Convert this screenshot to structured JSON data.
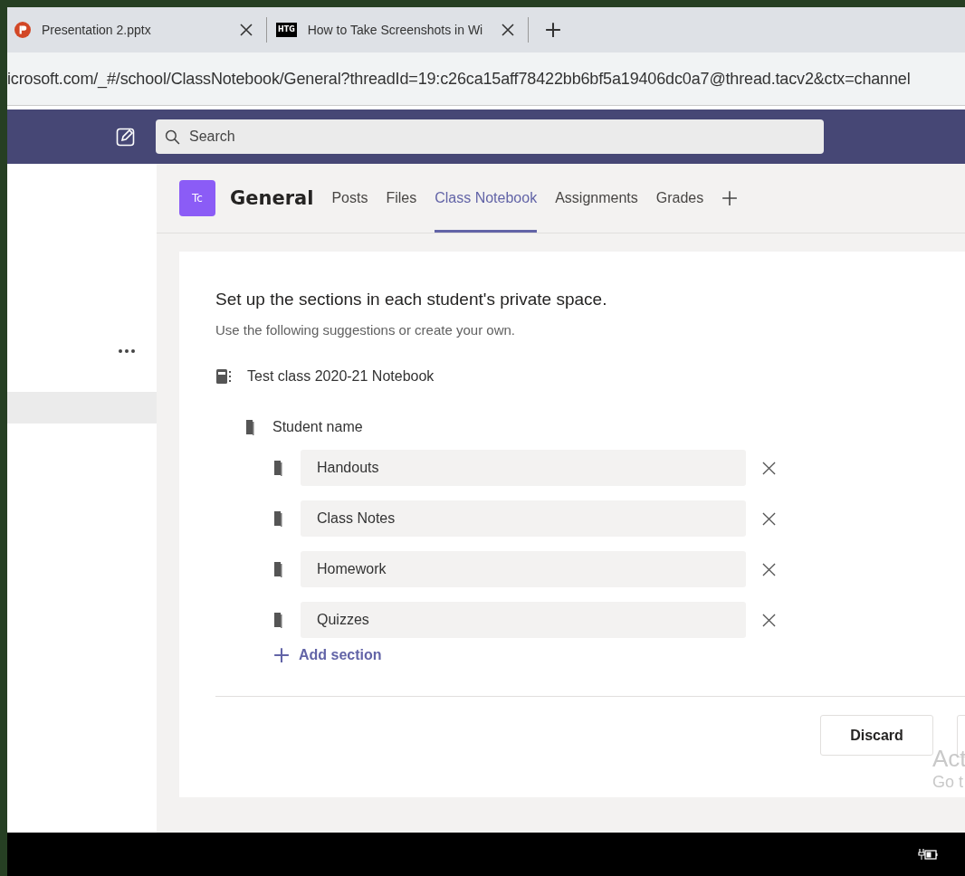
{
  "browser": {
    "tabs": [
      {
        "title": "Presentation 2.pptx",
        "kind": "powerpoint",
        "selected": false
      },
      {
        "title": "How to Take Screenshots in Wi",
        "kind": "htg",
        "selected": false
      }
    ],
    "favicon_text": "HTG",
    "address": "icrosoft.com/_#/school/ClassNotebook/General?threadId=19:c26ca15aff78422bb6bf5a19406dc0a7@thread.tacv2&ctx=channel"
  },
  "teams": {
    "search": {
      "placeholder": "Search"
    },
    "channel": {
      "avatar": "Tc",
      "name": "General",
      "tabs": [
        {
          "label": "Posts",
          "selected": false
        },
        {
          "label": "Files",
          "selected": false
        },
        {
          "label": "Class Notebook",
          "selected": true
        },
        {
          "label": "Assignments",
          "selected": false
        },
        {
          "label": "Grades",
          "selected": false
        }
      ]
    },
    "card": {
      "title": "Set up the sections in each student's private space.",
      "subtitle": "Use the following suggestions or create your own.",
      "notebook": "Test class 2020-21 Notebook",
      "student": "Student name",
      "sections": [
        "Handouts",
        "Class Notes",
        "Homework",
        "Quizzes"
      ],
      "add_section": "Add section",
      "buttons": [
        "Discard"
      ]
    }
  },
  "overlay": [
    "Act",
    "Go t"
  ]
}
